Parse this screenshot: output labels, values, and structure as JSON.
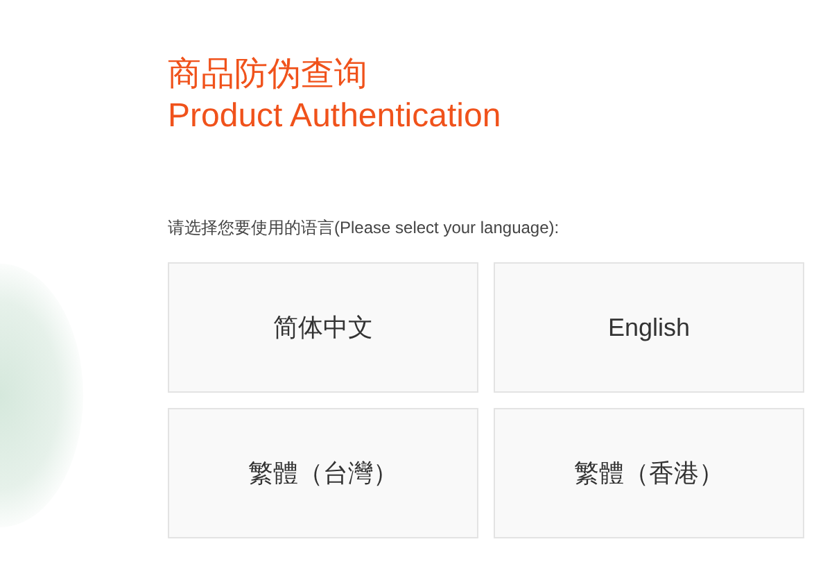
{
  "title": "商品防伪查询",
  "subtitle": "Product Authentication",
  "prompt": "请选择您要使用的语言(Please select your language):",
  "languages": [
    {
      "label": "简体中文"
    },
    {
      "label": "English"
    },
    {
      "label": "繁體（台灣）"
    },
    {
      "label": "繁體（香港）"
    }
  ]
}
